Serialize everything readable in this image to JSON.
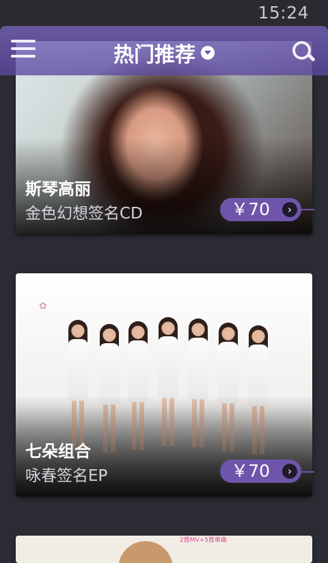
{
  "status_bar": {
    "time": "15:24"
  },
  "header": {
    "title": "热门推荐",
    "menu_icon": "menu-icon",
    "dropdown_icon": "chevron-down-icon",
    "search_icon": "search-icon",
    "accent_color": "#6e55ab"
  },
  "cards": [
    {
      "name": "斯琴高丽",
      "subtitle": "金色幻想签名CD",
      "price": "￥70"
    },
    {
      "name": "七朵组合",
      "subtitle": "咏春签名EP",
      "price": "￥70"
    },
    {
      "partial_text": "2首MV+5首单曲"
    }
  ]
}
